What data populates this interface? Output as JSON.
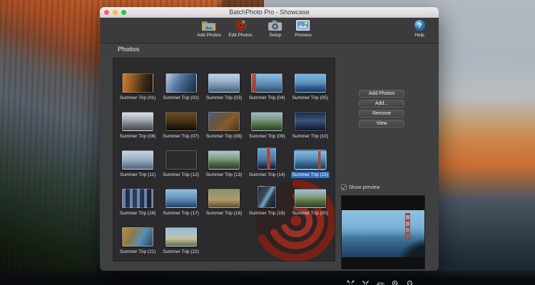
{
  "window": {
    "title": "BatchPhoto Pro - Showcase"
  },
  "toolbar": {
    "items": [
      {
        "label": "Add Photos",
        "icon": "add-photos-icon"
      },
      {
        "label": "Edit Photos",
        "icon": "edit-photos-icon"
      },
      {
        "label": "Setup",
        "icon": "setup-icon"
      },
      {
        "label": "Process",
        "icon": "process-icon"
      }
    ],
    "help": {
      "label": "Help",
      "icon": "help-icon"
    }
  },
  "photos": {
    "header": "Photos",
    "items": [
      {
        "label": "Summer Trip (01)",
        "thumb": "linear-gradient(100deg,#d08434 0%,#8a5222 38%,#3a2a16 70%,#1c140c 100%)"
      },
      {
        "label": "Summer Trip (02)",
        "thumb": "linear-gradient(120deg,#a6bcd8 8%,#5878a0 40%,#2c4666 75%,#1c2c44 100%)"
      },
      {
        "label": "Summer Trip (03)",
        "thumb": "linear-gradient(180deg,#bdd3e6 0%,#93acc4 45%,#647e9a 78%,#46607c 100%)"
      },
      {
        "label": "Summer Trip (04)",
        "thumb": "linear-gradient(90deg,rgba(178,62,44,.85) 0 14%,rgba(0,0,0,0) 14%),linear-gradient(180deg,#8cc0e6 0%,#5d8cb4 55%,#2f4e6c 100%)"
      },
      {
        "label": "Summer Trip (05)",
        "thumb": "linear-gradient(180deg,#7fb3dd 0%,#5d92c0 50%,#2f5a88 75%,#1c3a5c 100%)"
      },
      {
        "label": "Summer Trip (06)",
        "thumb": "linear-gradient(180deg,#dadee2 0%,#a6acb4 40%,#6a7078 72%,#42484e 100%)"
      },
      {
        "label": "Summer Trip (07)",
        "thumb": "linear-gradient(180deg,#6a4c26 0%,#4a3418 45%,#241a0e 80%,#100c06 100%)"
      },
      {
        "label": "Summer Trip (08)",
        "thumb": "linear-gradient(135deg,#4a5e88 0%,#6a5638 42%,#8a5c30 60%,#4c3418 100%)"
      },
      {
        "label": "Summer Trip (09)",
        "thumb": "linear-gradient(180deg,#9db9cc 0%,#7e9a84 38%,#54724a 66%,#2c3e26 100%)"
      },
      {
        "label": "Summer Trip (10)",
        "thumb": "linear-gradient(180deg,#1e2c48 0%,#3c5478 45%,#26385c 70%,#0e1828 100%)"
      },
      {
        "label": "Summer Trip (11)",
        "thumb": "linear-gradient(180deg,#c6d4e0 0%,#9cafc0 48%,#6c8096 80%,#50647a 100%)"
      },
      {
        "label": "Summer Trip (12)",
        "thumb": "linear-gradient(180deg,#bcc8d4 0%,#8headb0 40%,#84929e 42%,#54667a 100%)"
      },
      {
        "label": "Summer Trip (13)",
        "thumb": "linear-gradient(180deg,#a9c6de 0%,#7e9a78 45%,#4c6644 72%,#2c3c26 100%)"
      },
      {
        "label": "Summer Trip (14)",
        "portrait": true,
        "thumb": "linear-gradient(90deg,rgba(0,0,0,0) 0 52%,#b5412c 52% 68%,rgba(0,0,0,0) 68%),linear-gradient(180deg,#6aa4d4 0%,#4a7aa6 55%,#22364e 85%,#101c2c 100%)"
      },
      {
        "label": "Summer Trip (15)",
        "selected": true,
        "thumb": "linear-gradient(90deg,rgba(0,0,0,0) 0 76%,rgba(181,65,44,.9) 76% 85%,rgba(0,0,0,0) 85%),linear-gradient(180deg,#85b9dc 0%,#5c90b6 45%,#38648c 70%,#20405c 100%)"
      },
      {
        "label": "Summer Trip (16)",
        "thumb": "repeating-linear-gradient(90deg,rgba(190,210,240,.5) 0 4px,rgba(0,0,0,0) 4px 10px),linear-gradient(100deg,#182444 0%,#2c4064 45%,#101a30 100%)"
      },
      {
        "label": "Summer Trip (17)",
        "thumb": "linear-gradient(180deg,#8fbce0 0%,#6694bc 50%,#3c628a 78%,#24425e 100%)"
      },
      {
        "label": "Summer Trip (18)",
        "thumb": "linear-gradient(180deg,#7a9c6a 0%,#a5966a 42%,#b49a6a 58%,#5c4c30 100%)"
      },
      {
        "label": "Summer Trip (19)",
        "portrait": true,
        "thumb": "linear-gradient(120deg,#2a323e 0%,#3c4a58 38%,#7aaacc 52%,#2a3a4a 66%,#161e28 100%)"
      },
      {
        "label": "Summer Trip (20)",
        "thumb": "linear-gradient(180deg,#9cc0dc 0%,#7e9a72 45%,#54683e 70%,#323e24 100%)"
      },
      {
        "label": "Summer Trip (21)",
        "thumb": "linear-gradient(120deg,#c08a3c 0%,#8a7a4c 35%,#5a90b4 60%,#28486a 100%)"
      },
      {
        "label": "Summer Trip (22)",
        "thumb": "linear-gradient(180deg,#8fc0e4 0%,#b8c2b0 48%,#c8c0a0 60%,#5c6c42 100%)"
      }
    ]
  },
  "right_panel": {
    "buttons": [
      "Add Photos",
      "Add...",
      "Remove",
      "View"
    ],
    "show_preview_label": "Show preview",
    "show_preview_checked": true,
    "zoom_level": "4%"
  },
  "colors": {
    "selection": "#2e6fc1",
    "window_bg": "#3f4042",
    "panel_bg": "#2b2b2d",
    "titlebar_text": "#3c3c3c",
    "traffic_red": "#ff5f57",
    "traffic_yellow": "#febc2e",
    "traffic_green": "#28c840",
    "swirl_red": "#8f2318",
    "help_blue": "#3b8fd0"
  }
}
